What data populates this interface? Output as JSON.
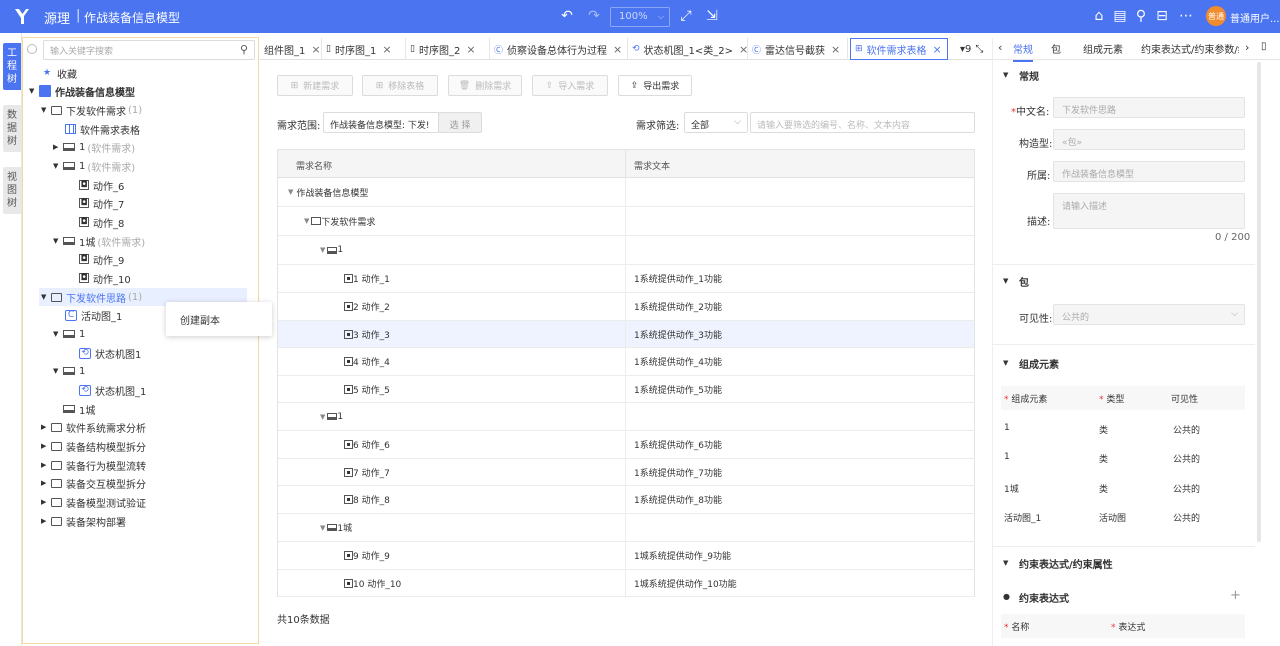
{
  "header": {
    "app_name": "源理",
    "separator": "|",
    "model_title": "作战装备信息模型",
    "zoom": "100%",
    "user_badge": "普通",
    "username": "普通用户..."
  },
  "vtabs": [
    "工程树",
    "数据树",
    "视图树"
  ],
  "tree": {
    "search_placeholder": "输入关键字搜索",
    "favorites": "收藏",
    "root": "作战装备信息模型",
    "items": [
      {
        "label": "下发软件需求",
        "extra": "(1)"
      },
      {
        "label": "软件需求表格",
        "extra": ""
      },
      {
        "label": "1",
        "extra": "(软件需求)"
      },
      {
        "label": "1",
        "extra": "(软件需求)"
      },
      {
        "label": "动作_6",
        "extra": ""
      },
      {
        "label": "动作_7",
        "extra": ""
      },
      {
        "label": "动作_8",
        "extra": ""
      },
      {
        "label": "1城",
        "extra": "(软件需求)"
      },
      {
        "label": "动作_9",
        "extra": ""
      },
      {
        "label": "动作_10",
        "extra": ""
      },
      {
        "label": "下发软件思路",
        "extra": "(1)"
      },
      {
        "label": "活动图_1",
        "extra": ""
      },
      {
        "label": "1",
        "extra": ""
      },
      {
        "label": "状态机图1",
        "extra": ""
      },
      {
        "label": "1",
        "extra": ""
      },
      {
        "label": "状态机图_1",
        "extra": ""
      },
      {
        "label": "1城",
        "extra": ""
      },
      {
        "label": "软件系统需求分析",
        "extra": ""
      },
      {
        "label": "装备结构模型拆分",
        "extra": ""
      },
      {
        "label": "装备行为模型流转",
        "extra": ""
      },
      {
        "label": "装备交互模型拆分",
        "extra": ""
      },
      {
        "label": "装备模型测试验证",
        "extra": ""
      },
      {
        "label": "装备架构部署",
        "extra": ""
      }
    ],
    "context_menu": "创建副本"
  },
  "tabs": [
    "组件图_1",
    "时序图_1",
    "时序图_2",
    "侦察设备总体行为过程",
    "状态机图_1<类_2>",
    "雷达信号截获",
    "软件需求表格",
    "9"
  ],
  "toolbar": {
    "new_req": "新建需求",
    "remove_table": "移除表格",
    "delete_req": "删除需求",
    "import_req": "导入需求",
    "export_req": "导出需求"
  },
  "filter": {
    "scope_label": "需求范围:",
    "scope_value": "作战装备信息模型: 下发!",
    "select_btn": "选 择",
    "filter_label": "需求筛选:",
    "filter_value": "全部",
    "search_placeholder": "请输入要筛选的编号、名称、文本内容"
  },
  "grid": {
    "col_name": "需求名称",
    "col_text": "需求文本",
    "rows": [
      {
        "name": "作战装备信息模型",
        "text": ""
      },
      {
        "name": "下发软件需求",
        "text": ""
      },
      {
        "name": "1",
        "text": ""
      },
      {
        "name": "1 动作_1",
        "text": "1系统提供动作_1功能"
      },
      {
        "name": "2 动作_2",
        "text": "1系统提供动作_2功能"
      },
      {
        "name": "3 动作_3",
        "text": "1系统提供动作_3功能"
      },
      {
        "name": "4 动作_4",
        "text": "1系统提供动作_4功能"
      },
      {
        "name": "5 动作_5",
        "text": "1系统提供动作_5功能"
      },
      {
        "name": "1",
        "text": ""
      },
      {
        "name": "6 动作_6",
        "text": "1系统提供动作_6功能"
      },
      {
        "name": "7 动作_7",
        "text": "1系统提供动作_7功能"
      },
      {
        "name": "8 动作_8",
        "text": "1系统提供动作_8功能"
      },
      {
        "name": "1城",
        "text": ""
      },
      {
        "name": "9 动作_9",
        "text": "1城系统提供动作_9功能"
      },
      {
        "name": "10 动作_10",
        "text": "1城系统提供动作_10功能"
      }
    ],
    "footer": "共10条数据"
  },
  "props": {
    "tabs": [
      "常规",
      "包",
      "组成元素",
      "约束表达式/约束参数/约"
    ],
    "general": {
      "title": "常规",
      "cn_name_label": "中文名:",
      "cn_name_value": "下发软件思路",
      "stereotype_label": "构造型:",
      "stereotype_value": "«包»",
      "owner_label": "所属:",
      "owner_value": "作战装备信息模型",
      "desc_label": "描述:",
      "desc_placeholder": "请输入描述",
      "counter": "0 / 200"
    },
    "package": {
      "title": "包",
      "visibility_label": "可见性:",
      "visibility_value": "公共的"
    },
    "elements": {
      "title": "组成元素",
      "headers": [
        "组成元素",
        "类型",
        "可见性"
      ],
      "rows": [
        [
          "1",
          "类",
          "公共的"
        ],
        [
          "1",
          "类",
          "公共的"
        ],
        [
          "1城",
          "类",
          "公共的"
        ],
        [
          "活动图_1",
          "活动图",
          "公共的"
        ]
      ]
    },
    "constraints": {
      "title": "约束表达式/约束属性",
      "sub_title": "约束表达式",
      "headers": [
        "名称",
        "表达式"
      ]
    }
  }
}
